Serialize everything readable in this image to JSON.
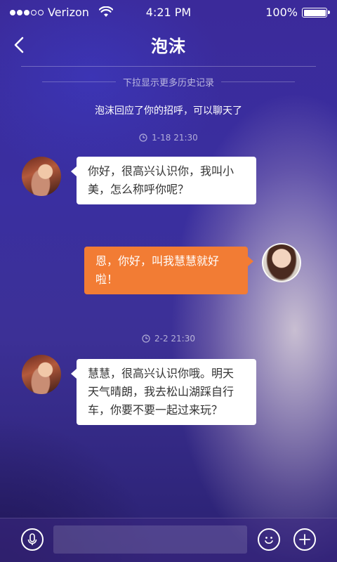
{
  "status_bar": {
    "carrier": "Verizon",
    "time": "4:21 PM",
    "battery": "100%",
    "signal_bars_filled": 3,
    "signal_bars_total": 5
  },
  "nav": {
    "title": "泡沫",
    "back_icon": "chevron-left-icon"
  },
  "history": {
    "hint": "下拉显示更多历史记录"
  },
  "system_message": "泡沫回应了你的招呼，可以聊天了",
  "timestamps": [
    "1-18   21:30",
    "2-2   21:30"
  ],
  "messages": [
    {
      "from": "other",
      "text_lines": [
        "你好，很高兴认识你，我叫小",
        "美，怎么称呼你呢？"
      ]
    },
    {
      "from": "me",
      "text_lines": [
        "恩，你好，叫我慧慧就好啦！"
      ]
    },
    {
      "from": "other",
      "text_lines": [
        "慧慧，很高兴认识你哦。明天",
        "天气晴朗，我去松山湖踩自行",
        "车，你要不要一起过来玩？"
      ]
    }
  ],
  "composer": {
    "mic_icon": "microphone-icon",
    "input_value": "",
    "emoji_icon": "smiley-icon",
    "add_icon": "plus-icon"
  },
  "colors": {
    "outgoing_bubble": "#f27c34",
    "incoming_bubble": "#ffffff",
    "background": "#3b2a9a"
  }
}
